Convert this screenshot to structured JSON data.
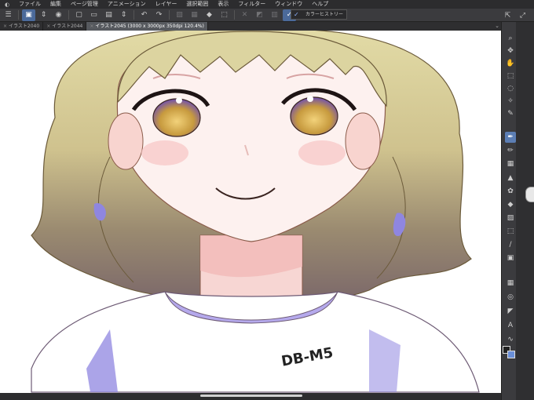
{
  "menubar": {
    "items": [
      "ファイル",
      "編集",
      "ページ管理",
      "アニメーション",
      "レイヤー",
      "選択範囲",
      "表示",
      "フィルター",
      "ウィンドウ",
      "ヘルプ"
    ]
  },
  "toolbar": {
    "popup_label": "カラーヒストリー"
  },
  "tabs": [
    {
      "label": "イラスト2040",
      "active": false
    },
    {
      "label": "イラスト2044",
      "active": false
    },
    {
      "label": "イラスト2045 (3000 x 3000px 350dpi 120.4%)",
      "active": true
    }
  ],
  "canvas": {
    "signature": "DB-M5"
  },
  "colors": {
    "ui_dark": "#3b3b3e",
    "accent": "#5c7eb4",
    "hair": "#d8cfa0",
    "eye": "#c8a040",
    "shirt_shadow": "#8f86e0"
  }
}
